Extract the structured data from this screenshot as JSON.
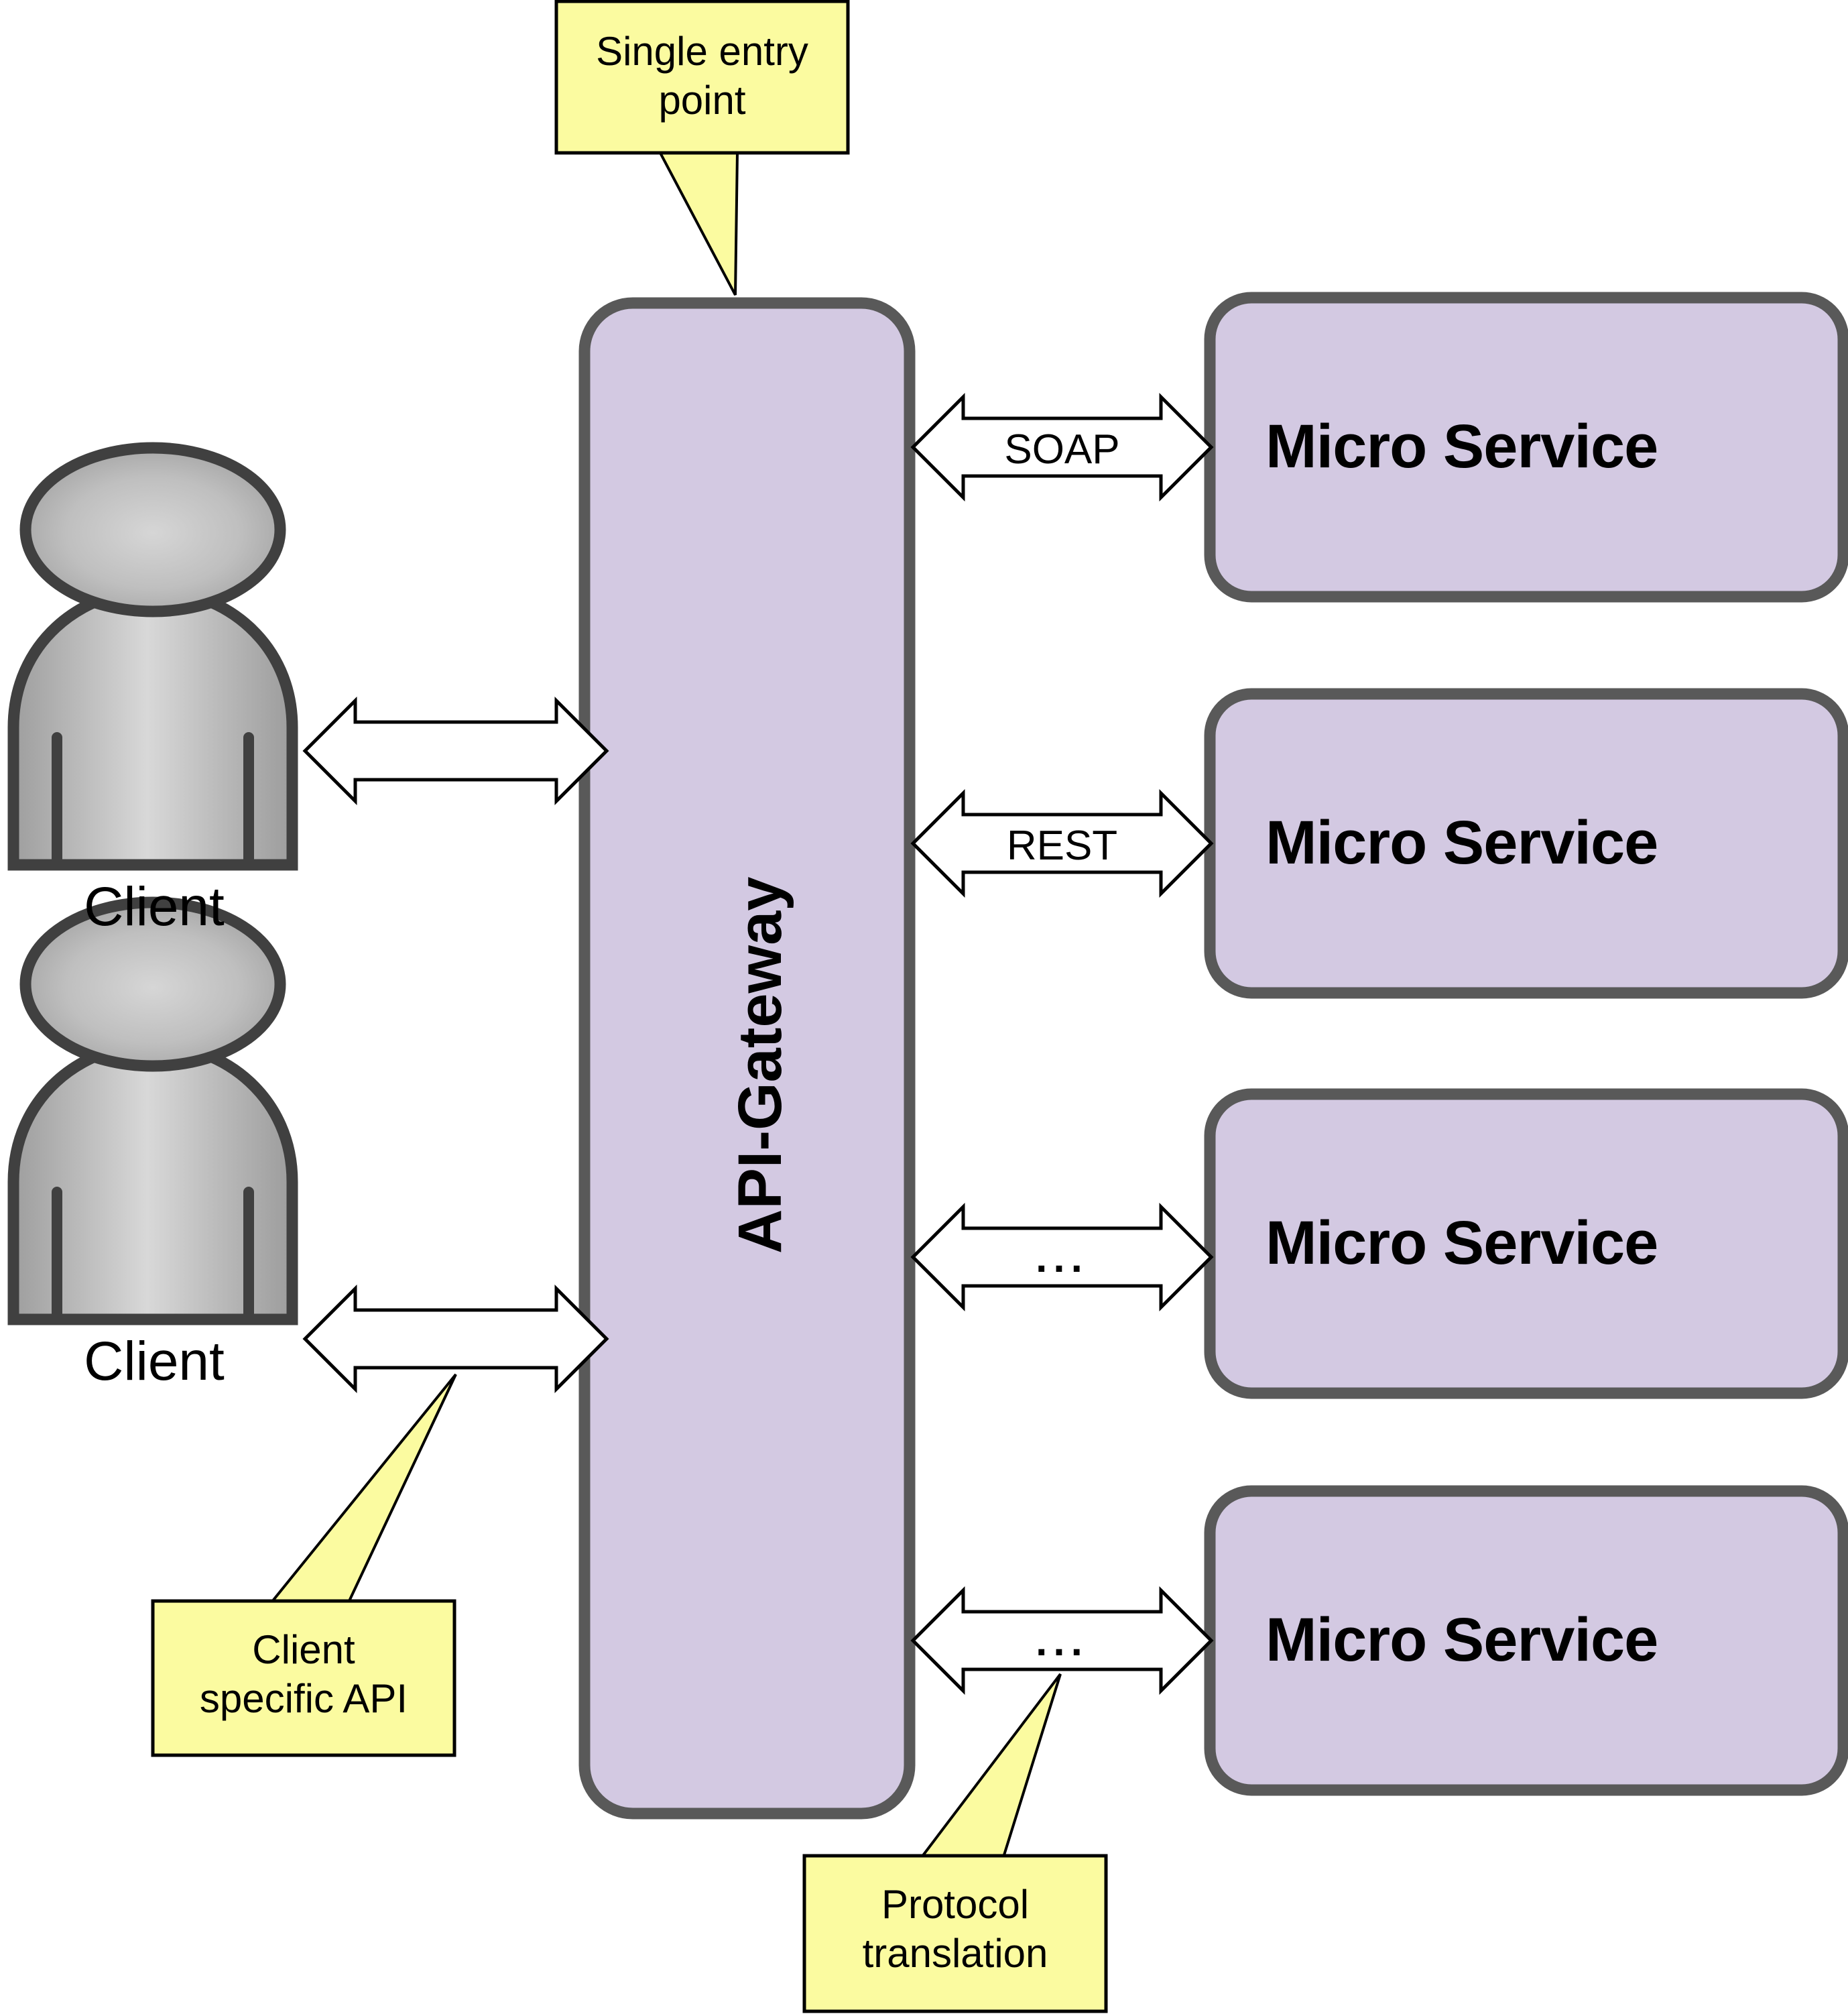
{
  "diagram": {
    "title": "API-Gateway microservice architecture diagram",
    "colors": {
      "node_fill": "#d3c9e2",
      "node_stroke": "#595959",
      "callout_fill": "#fbfba0",
      "callout_stroke": "#000000",
      "actor_stroke": "#404040",
      "arrow_fill": "#ffffff",
      "arrow_stroke": "#000000",
      "background": "#ffffff",
      "text": "#000000"
    }
  },
  "gateway": {
    "label": "API-Gateway"
  },
  "actors": [
    {
      "label": "Client",
      "icon": "person-icon"
    },
    {
      "label": "Client",
      "icon": "person-icon"
    }
  ],
  "services": [
    {
      "label": "Micro Service",
      "protocol": "SOAP"
    },
    {
      "label": "Micro Service",
      "protocol": "REST"
    },
    {
      "label": "Micro Service",
      "protocol": "..."
    },
    {
      "label": "Micro Service",
      "protocol": "..."
    }
  ],
  "client_links": [
    {
      "protocol": ""
    },
    {
      "protocol": ""
    }
  ],
  "callouts": [
    {
      "id": "single-entry-point",
      "lines": [
        "Single entry",
        "point"
      ]
    },
    {
      "id": "client-specific-api",
      "lines": [
        "Client",
        "specific API"
      ]
    },
    {
      "id": "protocol-translation",
      "lines": [
        "Protocol",
        "translation"
      ]
    }
  ]
}
